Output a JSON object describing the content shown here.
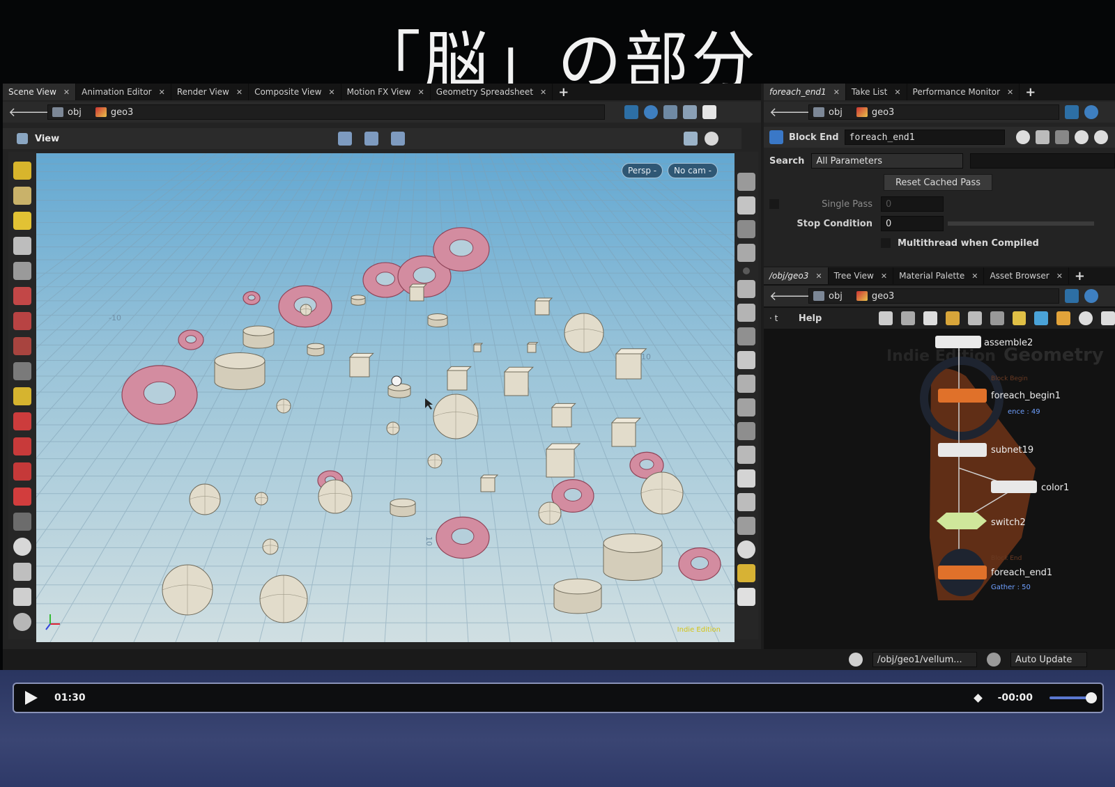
{
  "slide_title": "「脳」の部分",
  "left_tabs": [
    {
      "label": "Scene View",
      "active": true
    },
    {
      "label": "Animation Editor",
      "active": false
    },
    {
      "label": "Render View",
      "active": false
    },
    {
      "label": "Composite View",
      "active": false
    },
    {
      "label": "Motion FX View",
      "active": false
    },
    {
      "label": "Geometry Spreadsheet",
      "active": false
    }
  ],
  "left_path": {
    "root": "obj",
    "node": "geo3"
  },
  "viewport": {
    "header_label": "View",
    "camera_persp": "Persp -",
    "camera_cam": "No cam -",
    "watermark": "Indie Edition",
    "grid_label_left": "-10",
    "grid_label_bottom": "10",
    "grid_label_right": "10"
  },
  "right_tabs": [
    {
      "label": "foreach_end1",
      "active": true
    },
    {
      "label": "Take List",
      "active": false
    },
    {
      "label": "Performance Monitor",
      "active": false
    }
  ],
  "right_path": {
    "root": "obj",
    "node": "geo3"
  },
  "params": {
    "node_type": "Block End",
    "node_name": "foreach_end1",
    "search_label": "Search",
    "search_filter": "All Parameters",
    "reset_button": "Reset Cached Pass",
    "single_pass_label": "Single Pass",
    "single_pass_value": "0",
    "stop_condition_label": "Stop Condition",
    "stop_condition_value": "0",
    "multithread_label": "Multithread when Compiled"
  },
  "network_tabs": [
    {
      "label": "/obj/geo3",
      "active": true
    },
    {
      "label": "Tree View",
      "active": false
    },
    {
      "label": "Material Palette",
      "active": false
    },
    {
      "label": "Asset Browser",
      "active": false
    }
  ],
  "network_path": {
    "root": "obj",
    "node": "geo3"
  },
  "network": {
    "help_label": "Help",
    "watermark_left": "Indie Edition",
    "watermark_right": "Geometry",
    "nodes": {
      "assemble": "assemble2",
      "foreach_begin": "foreach_begin1",
      "foreach_begin_kind": "Block Begin",
      "foreach_begin_sub": "ence : 49",
      "subnet": "subnet19",
      "color": "color1",
      "switch": "switch2",
      "foreach_end": "foreach_end1",
      "foreach_end_kind": "Block End",
      "foreach_end_sub": "Gather : 50"
    }
  },
  "status": {
    "path": "/obj/geo1/vellum...",
    "update_mode": "Auto Update"
  },
  "player": {
    "time_current": "01:30",
    "time_remaining": "-00:00",
    "volume_level": 1.0
  },
  "colors": {
    "torus": "#d38ca0",
    "torus_line": "#8f4458",
    "solid": "#e2dccb",
    "solid_line": "#6f6a5a",
    "network_loop": "#6e3418"
  }
}
